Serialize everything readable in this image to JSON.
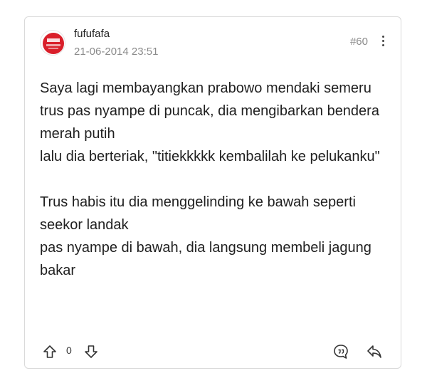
{
  "post": {
    "username": "fufufafa",
    "date": "21-06-2014 23:51",
    "post_number": "#60",
    "content": "Saya lagi membayangkan prabowo mendaki semeru\ntrus pas nyampe di puncak, dia mengibarkan bendera merah putih\nlalu dia berteriak, \"titiekkkkk kembalilah ke pelukanku\"\n\nTrus habis itu dia menggelinding ke bawah seperti seekor landak\npas nyampe di bawah, dia langsung membeli jagung bakar",
    "vote_count": "0"
  },
  "icons": {
    "avatar": "user-avatar",
    "more": "more-vertical-icon",
    "upvote": "arrow-up-icon",
    "downvote": "arrow-down-icon",
    "quote": "quote-bubble-icon",
    "reply": "reply-icon"
  },
  "colors": {
    "accent_red": "#d91f2a",
    "muted_text": "#8a8a8a",
    "border": "#d9d9d9"
  }
}
